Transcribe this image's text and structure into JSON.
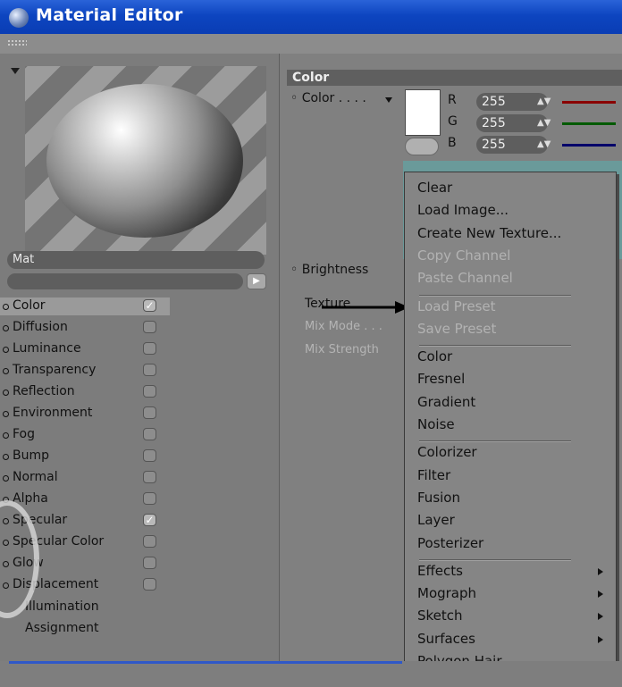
{
  "window": {
    "title": "Material Editor"
  },
  "material": {
    "name": "Mat"
  },
  "channels": [
    {
      "label": "Color",
      "checked": true,
      "selected": true
    },
    {
      "label": "Diffusion",
      "checked": false
    },
    {
      "label": "Luminance",
      "checked": false
    },
    {
      "label": "Transparency",
      "checked": false
    },
    {
      "label": "Reflection",
      "checked": false
    },
    {
      "label": "Environment",
      "checked": false
    },
    {
      "label": "Fog",
      "checked": false
    },
    {
      "label": "Bump",
      "checked": false
    },
    {
      "label": "Normal",
      "checked": false
    },
    {
      "label": "Alpha",
      "checked": false
    },
    {
      "label": "Specular",
      "checked": true
    },
    {
      "label": "Specular Color",
      "checked": false
    },
    {
      "label": "Glow",
      "checked": false
    },
    {
      "label": "Displacement",
      "checked": false
    }
  ],
  "extra_items": [
    "Illumination",
    "Assignment"
  ],
  "color_section": {
    "header": "Color",
    "color_label": "Color",
    "r_label": "R",
    "r_value": "255",
    "g_label": "G",
    "g_value": "255",
    "b_label": "B",
    "b_value": "255",
    "brightness_label": "Brightness",
    "texture_label": "Texture",
    "mix_mode_label": "Mix Mode",
    "mix_strength_label": "Mix Strength",
    "colors": {
      "r": "#8a0000",
      "g": "#005a00",
      "b": "#00006a"
    }
  },
  "context_menu": {
    "groups": [
      [
        {
          "label": "Clear",
          "disabled": false
        },
        {
          "label": "Load Image...",
          "disabled": false
        },
        {
          "label": "Create New Texture...",
          "disabled": false
        },
        {
          "label": "Copy Channel",
          "disabled": true
        },
        {
          "label": "Paste Channel",
          "disabled": true
        }
      ],
      [
        {
          "label": "Load Preset",
          "disabled": true
        },
        {
          "label": "Save Preset",
          "disabled": true
        }
      ],
      [
        {
          "label": "Color",
          "disabled": false
        },
        {
          "label": "Fresnel",
          "disabled": false
        },
        {
          "label": "Gradient",
          "disabled": false
        },
        {
          "label": "Noise",
          "disabled": false
        }
      ],
      [
        {
          "label": "Colorizer",
          "disabled": false
        },
        {
          "label": "Filter",
          "disabled": false
        },
        {
          "label": "Fusion",
          "disabled": false
        },
        {
          "label": "Layer",
          "disabled": false
        },
        {
          "label": "Posterizer",
          "disabled": false
        }
      ],
      [
        {
          "label": "Effects",
          "disabled": false,
          "submenu": true
        },
        {
          "label": "Mograph",
          "disabled": false,
          "submenu": true
        },
        {
          "label": "Sketch",
          "disabled": false,
          "submenu": true
        },
        {
          "label": "Surfaces",
          "disabled": false,
          "submenu": true
        },
        {
          "label": "Polygon Hair",
          "disabled": false
        }
      ]
    ]
  }
}
